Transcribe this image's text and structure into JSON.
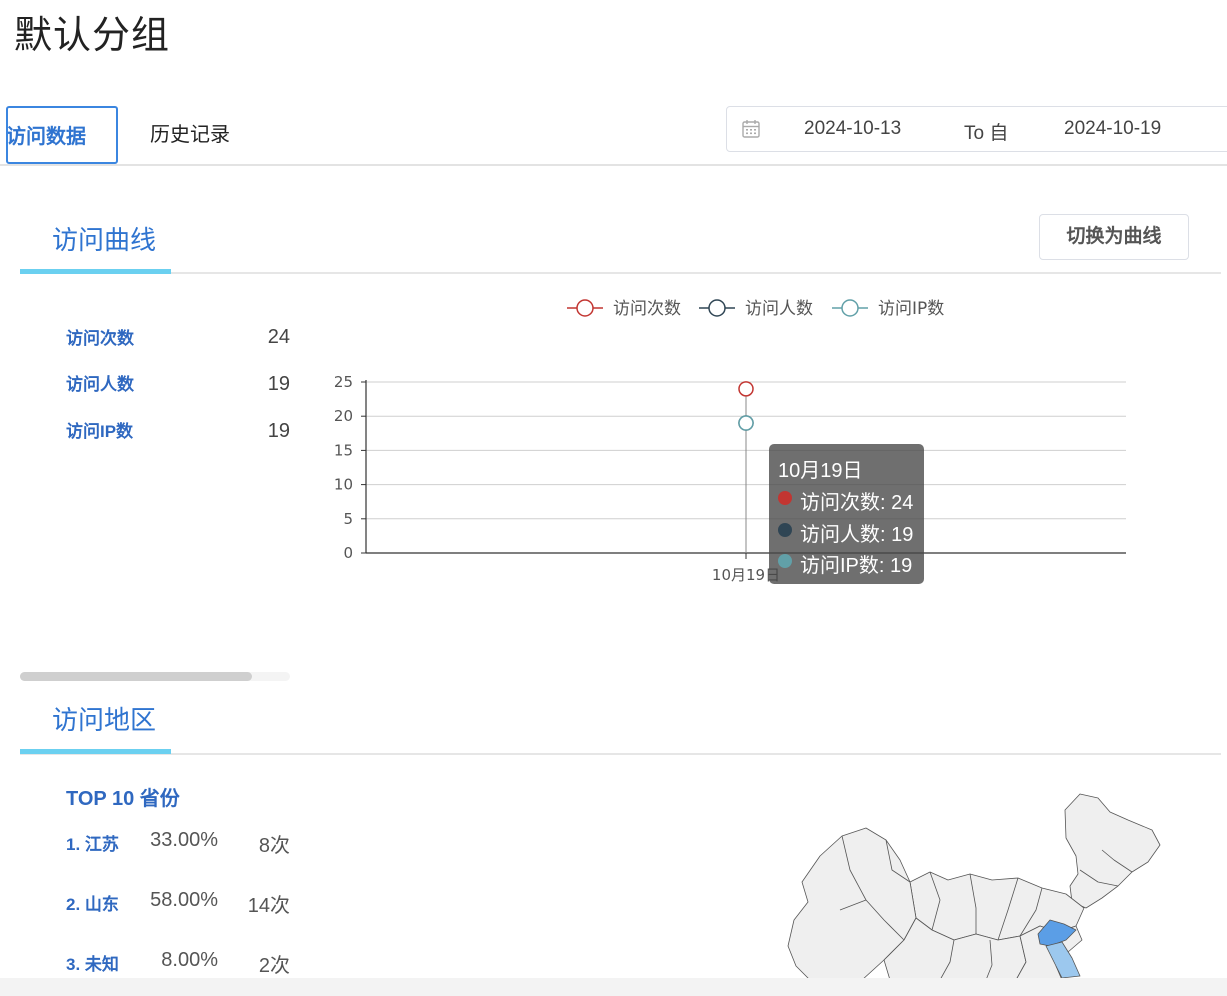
{
  "page_title": "默认分组",
  "tabs": [
    {
      "label": "访问数据",
      "active": true
    },
    {
      "label": "历史记录",
      "active": false
    }
  ],
  "date_range": {
    "icon": "calendar-icon",
    "start": "2024-10-13",
    "separator": "To 自",
    "end": "2024-10-19"
  },
  "visit_curve": {
    "title": "访问曲线",
    "switch_button": "切换为曲线",
    "stats": [
      {
        "label": "访问次数",
        "value": "24"
      },
      {
        "label": "访问人数",
        "value": "19"
      },
      {
        "label": "访问IP数",
        "value": "19"
      }
    ]
  },
  "chart_data": {
    "type": "line",
    "categories": [
      "10月19日"
    ],
    "series": [
      {
        "name": "访问次数",
        "values": [
          24
        ],
        "color": "#c23531"
      },
      {
        "name": "访问人数",
        "values": [
          19
        ],
        "color": "#2f4554"
      },
      {
        "name": "访问IP数",
        "values": [
          19
        ],
        "color": "#61a0a8"
      }
    ],
    "yticks": [
      "0",
      "5",
      "10",
      "15",
      "20",
      "25"
    ],
    "ylim": [
      0,
      25
    ],
    "legend_position": "top-center",
    "grid": true
  },
  "tooltip": {
    "title": "10月19日",
    "rows": [
      {
        "text": "访问次数: 24",
        "color": "#c23531"
      },
      {
        "text": "访问人数: 19",
        "color": "#2f4554"
      },
      {
        "text": "访问IP数: 19",
        "color": "#61a0a8"
      }
    ]
  },
  "visit_region": {
    "title": "访问地区",
    "top_title": "TOP 10 省份",
    "provinces": [
      {
        "name": "1. 江苏",
        "percent": "33.00%",
        "count": "8次"
      },
      {
        "name": "2. 山东",
        "percent": "58.00%",
        "count": "14次"
      },
      {
        "name": "3. 未知",
        "percent": "8.00%",
        "count": "2次"
      }
    ],
    "highlight_colors": {
      "high": "#5b9ee6",
      "mid": "#9cc8ee",
      "base": "#efefef"
    }
  }
}
